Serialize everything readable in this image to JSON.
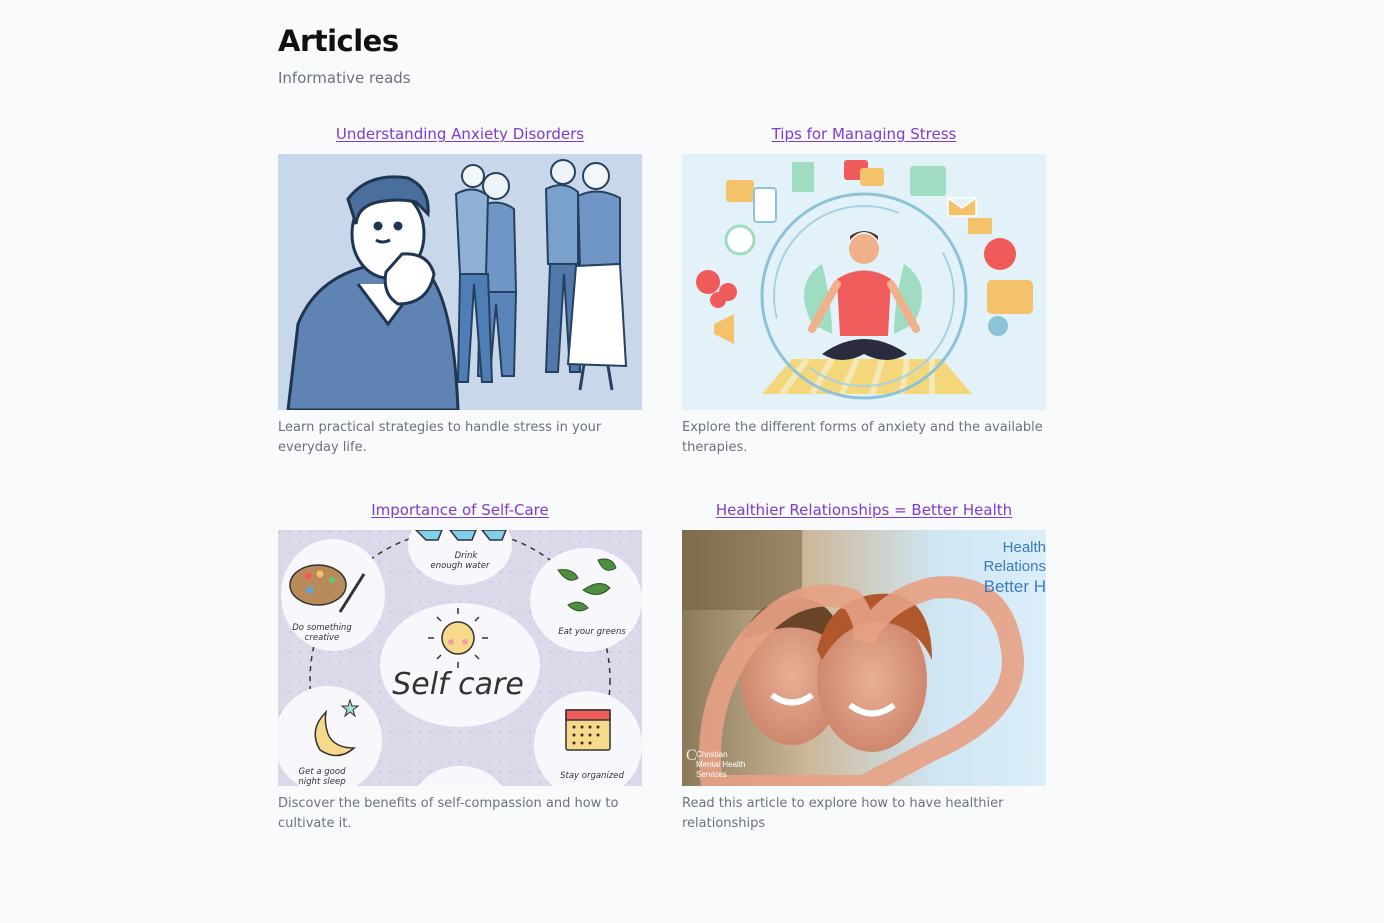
{
  "page": {
    "title": "Articles",
    "subtitle": "Informative reads"
  },
  "colors": {
    "link": "#7e3bd0",
    "muted": "#6b7280",
    "background": "#f9fafb"
  },
  "articles": [
    {
      "title": "Understanding Anxiety Disorders",
      "description": "Learn practical strategies to handle stress in your everyday life.",
      "image_icon": "anxious-man-illustration"
    },
    {
      "title": "Tips for Managing Stress",
      "description": "Explore the different forms of anxiety and the available therapies.",
      "image_icon": "meditating-man-illustration"
    },
    {
      "title": "Importance of Self-Care",
      "description": "Discover the benefits of self-compassion and how to cultivate it.",
      "image_icon": "self-care-illustration",
      "image_text": {
        "center": "Self care",
        "water": "Drink enough water",
        "creative": "Do something creative",
        "greens": "Eat your greens",
        "sleep": "Get a good night sleep",
        "organized": "Stay organized"
      }
    },
    {
      "title": "Healthier Relationships = Better Health",
      "description": "Read this article to explore how to have healthier relationships",
      "image_icon": "couple-heart-hands-photo",
      "image_text": {
        "line1": "Health",
        "line2": "Relations",
        "line3": "Better H",
        "logo_line1": "Christian",
        "logo_line2": "Mental Health",
        "logo_line3": "Services"
      }
    }
  ]
}
